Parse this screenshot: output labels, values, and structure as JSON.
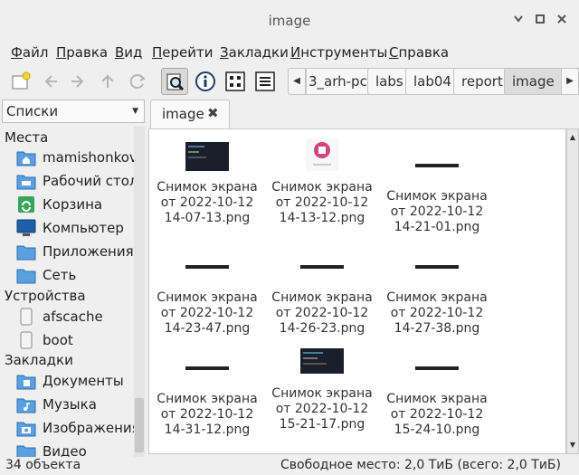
{
  "window": {
    "title": "image"
  },
  "menu": [
    {
      "label": "Файл",
      "u": "Ф",
      "rest": "айл"
    },
    {
      "label": "Правка",
      "u": "П",
      "rest": "равка"
    },
    {
      "label": "Вид",
      "u": "В",
      "rest": "ид"
    },
    {
      "label": "Перейти",
      "u": "П",
      "rest": "ерейти"
    },
    {
      "label": "Закладки",
      "u": "З",
      "rest": "акладки"
    },
    {
      "label": "Инструменты",
      "u": "И",
      "rest": "нструменты"
    },
    {
      "label": "Справка",
      "u": "С",
      "rest": "правка"
    }
  ],
  "breadcrumbs": [
    "3_arh-pc",
    "labs",
    "lab04",
    "report",
    "image"
  ],
  "sidebar": {
    "mode": "Списки",
    "sections": {
      "places": "Места",
      "devices": "Устройства",
      "bookmarks": "Закладки"
    },
    "places": [
      "mamishonkov",
      "Рабочий стол",
      "Корзина",
      "Компьютер",
      "Приложения",
      "Сеть"
    ],
    "devices": [
      "afscache",
      "boot"
    ],
    "bookmarks": [
      "Документы",
      "Музыка",
      "Изображения",
      "Видео"
    ]
  },
  "tab": {
    "label": "image",
    "close": "✖"
  },
  "files": [
    {
      "l1": "Снимок экрана",
      "l2": "от 2022-10-12",
      "l3": "14-07-13.png",
      "thumb": "dark"
    },
    {
      "l1": "Снимок экрана",
      "l2": "от 2022-10-12",
      "l3": "14-13-12.png",
      "thumb": "logo"
    },
    {
      "l1": "Снимок экрана",
      "l2": "от 2022-10-12",
      "l3": "14-21-01.png",
      "thumb": "line"
    },
    {
      "l1": "Снимок экрана",
      "l2": "от 2022-10-12",
      "l3": "14-23-47.png",
      "thumb": "line"
    },
    {
      "l1": "Снимок экрана",
      "l2": "от 2022-10-12",
      "l3": "14-26-23.png",
      "thumb": "line"
    },
    {
      "l1": "Снимок экрана",
      "l2": "от 2022-10-12",
      "l3": "14-27-38.png",
      "thumb": "line"
    },
    {
      "l1": "Снимок экрана",
      "l2": "от 2022-10-12",
      "l3": "14-31-12.png",
      "thumb": "line"
    },
    {
      "l1": "Снимок экрана",
      "l2": "от 2022-10-12",
      "l3": "15-21-17.png",
      "thumb": "dark"
    },
    {
      "l1": "Снимок экрана",
      "l2": "от 2022-10-12",
      "l3": "15-24-10.png",
      "thumb": "line"
    }
  ],
  "status": {
    "count": "34 объекта",
    "free": "Свободное место: 2,0 ТиБ (всего: 2,0 ТиБ)"
  },
  "colors": {
    "folder": "#4a90d9",
    "accent": "#3a6fb5",
    "logo": "#d0457a"
  }
}
